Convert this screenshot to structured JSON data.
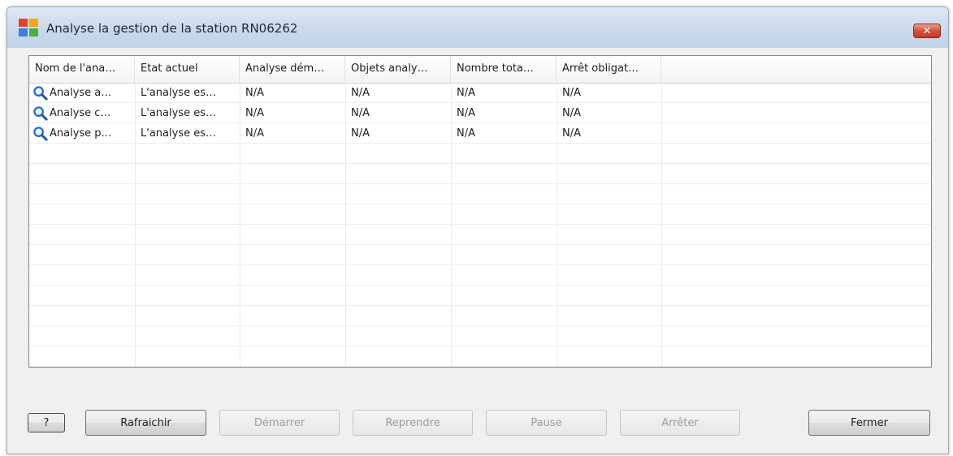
{
  "window": {
    "title": "Analyse la gestion de la station RN06262",
    "close_glyph": "✕"
  },
  "table": {
    "columns": [
      "Nom de l'ana…",
      "Etat actuel",
      "Analyse dém…",
      "Objets analy…",
      "Nombre tota…",
      "Arrêt obligat…"
    ],
    "rows": [
      [
        "Analyse a…",
        "L'analyse es…",
        "N/A",
        "N/A",
        "N/A",
        "N/A"
      ],
      [
        "Analyse c…",
        "L'analyse es…",
        "N/A",
        "N/A",
        "N/A",
        "N/A"
      ],
      [
        "Analyse p…",
        "L'analyse es…",
        "N/A",
        "N/A",
        "N/A",
        "N/A"
      ]
    ],
    "row_icon": "search-icon"
  },
  "buttons": {
    "help": "?",
    "refresh": "Rafraichir",
    "start": "Démarrer",
    "resume": "Reprendre",
    "pause": "Pause",
    "stop": "Arrêter",
    "close": "Fermer"
  },
  "colors": {
    "titlebar": "#cad9ec",
    "close_button": "#c8432b",
    "window_bg": "#f0f0f0",
    "icon_blue": "#2a6fc0"
  }
}
